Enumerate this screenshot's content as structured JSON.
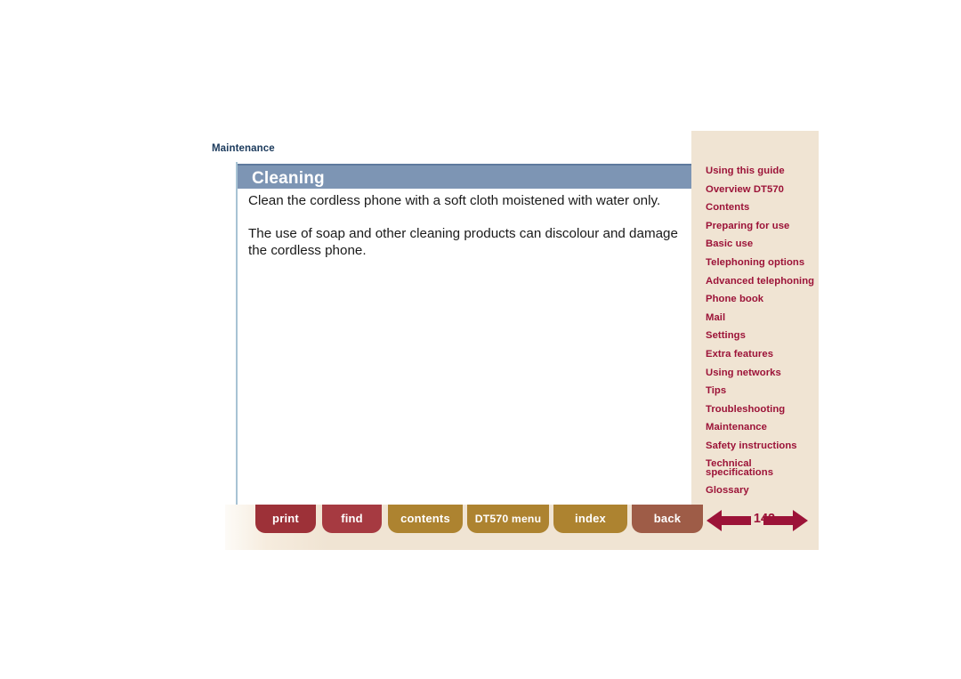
{
  "document": {
    "breadcrumb": "Maintenance",
    "section_title": "Cleaning",
    "paragraphs": [
      "Clean the cordless phone with a soft cloth moistened with water only.",
      "The use of soap and other cleaning products can discolour and damage the cordless phone."
    ]
  },
  "sidebar": {
    "items": [
      {
        "label": "Using this guide"
      },
      {
        "label": "Overview DT570"
      },
      {
        "label": "Contents"
      },
      {
        "label": "Preparing for use"
      },
      {
        "label": "Basic use"
      },
      {
        "label": "Telephoning options"
      },
      {
        "label": "Advanced telephoning"
      },
      {
        "label": "Phone book"
      },
      {
        "label": "Mail"
      },
      {
        "label": "Settings"
      },
      {
        "label": "Extra features"
      },
      {
        "label": "Using networks"
      },
      {
        "label": "Tips"
      },
      {
        "label": "Troubleshooting"
      },
      {
        "label": "Maintenance"
      },
      {
        "label": "Safety instructions"
      },
      {
        "label": "Technical specifications",
        "line1": "Technical",
        "line2": "specifications"
      },
      {
        "label": "Glossary"
      }
    ]
  },
  "pager": {
    "page_number": "142",
    "prev_icon": "arrow-left-icon",
    "next_icon": "arrow-right-icon"
  },
  "toolbar": {
    "print_label": "print",
    "find_label": "find",
    "contents_label": "contents",
    "dt570_menu_label": "DT570 menu",
    "index_label": "index",
    "back_label": "back"
  },
  "colors": {
    "title_band": "#7d95b4",
    "sidebar_bg": "#f0e4d3",
    "link_red": "#9c1338",
    "button_red": "#9d3138",
    "button_gold": "#ad8330",
    "button_brown": "#9e5c47",
    "breadcrumb": "#1b3a5c"
  }
}
